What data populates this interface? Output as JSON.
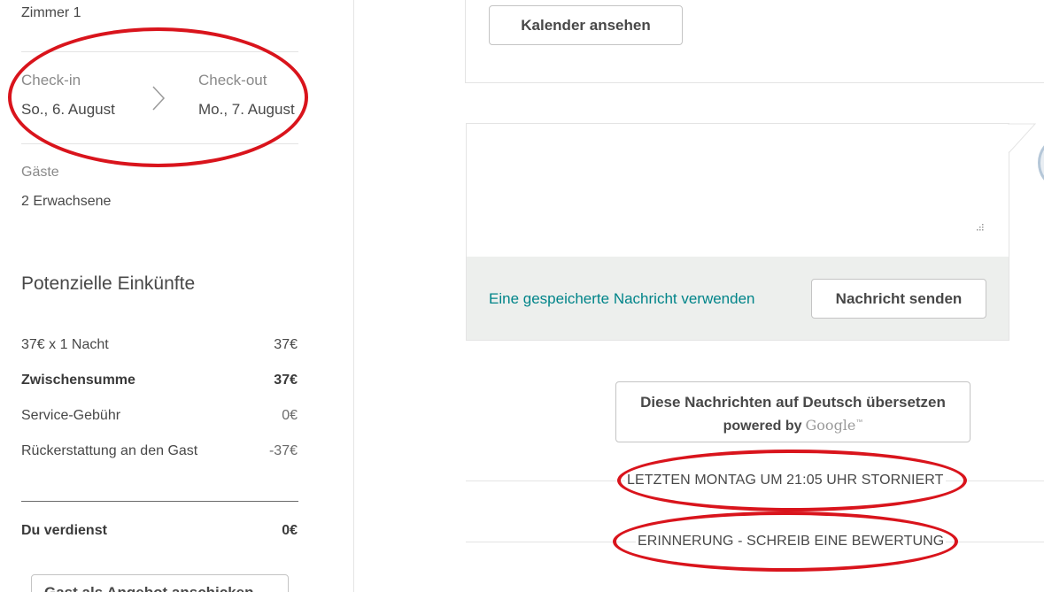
{
  "sidebar": {
    "room": "Zimmer 1",
    "checkin_label": "Check-in",
    "checkin_date": "So., 6. August",
    "checkout_label": "Check-out",
    "checkout_date": "Mo., 7. August",
    "guests_label": "Gäste",
    "guests_value": "2 Erwachsene",
    "earnings_title": "Potenzielle Einkünfte",
    "rows": [
      {
        "label": "37€ x 1 Nacht",
        "amount": "37€"
      },
      {
        "label": "Zwischensumme",
        "amount": "37€"
      },
      {
        "label": "Service-Gebühr",
        "amount": "0€"
      },
      {
        "label": "Rückerstattung an den Gast",
        "amount": "-37€"
      }
    ],
    "total_label": "Du verdienst",
    "total_amount": "0€",
    "bottom_button": "Gast als Angebot anschicken"
  },
  "main": {
    "calendar_button": "Kalender ansehen",
    "saved_message_link": "Eine gespeicherte Nachricht verwenden",
    "send_button": "Nachricht senden",
    "translate_line1": "Diese Nachrichten auf Deutsch übersetzen",
    "translate_powered": "powered by",
    "translate_brand": "Google",
    "translate_tm": "™",
    "divider_cancelled": "LETZTEN MONTAG UM 21:05 UHR STORNIERT",
    "divider_reminder": "ERINNERUNG - SCHREIB EINE BEWERTUNG"
  },
  "colors": {
    "link": "#008489",
    "annotation": "#d9141c",
    "footer_bg": "#edefed"
  },
  "icons": [
    "chevron-right-icon",
    "resize-grip-icon",
    "avatar"
  ]
}
